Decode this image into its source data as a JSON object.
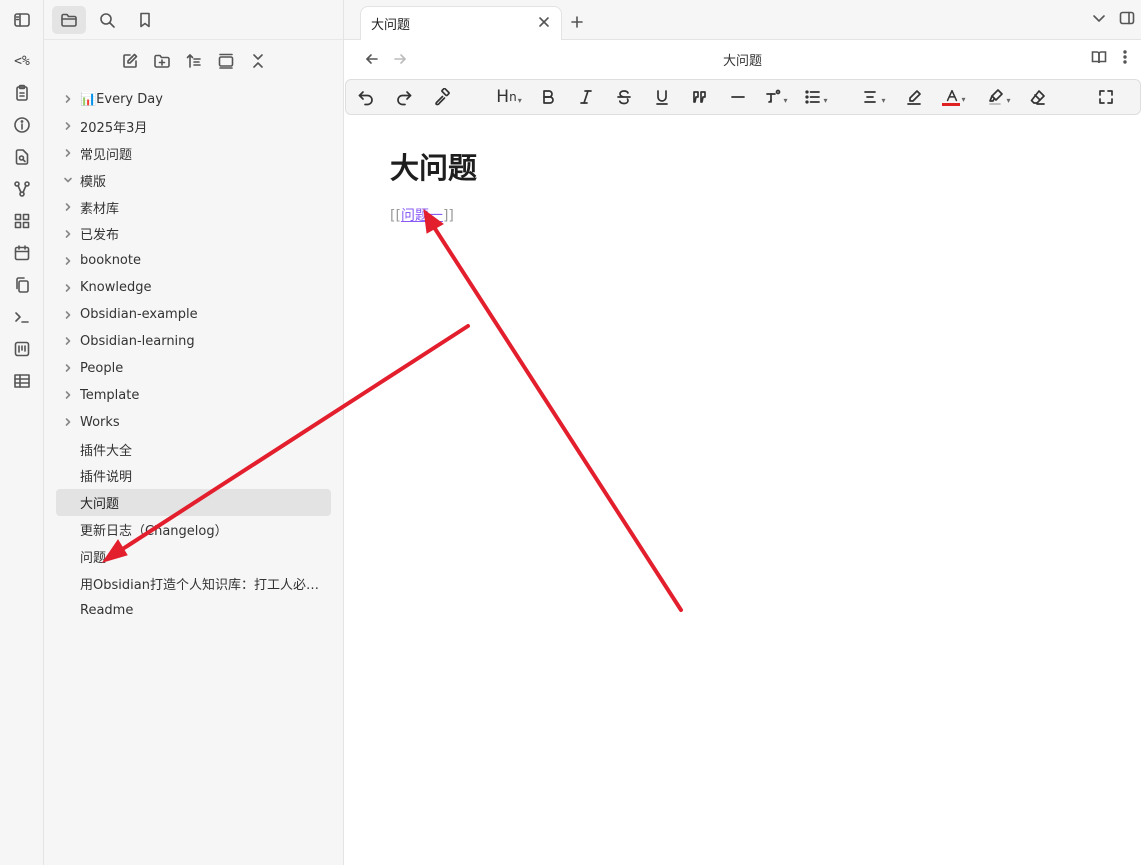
{
  "ribbon": {
    "items": [
      {
        "icon": "template-icon",
        "text": "<%"
      },
      {
        "icon": "clipboard-icon"
      },
      {
        "icon": "info-icon"
      },
      {
        "icon": "file-search-icon"
      },
      {
        "icon": "graph-icon"
      },
      {
        "icon": "grid-icon"
      },
      {
        "icon": "calendar-icon"
      },
      {
        "icon": "copy-icon"
      },
      {
        "icon": "terminal-icon"
      },
      {
        "icon": "kanban-icon"
      },
      {
        "icon": "table-icon"
      }
    ]
  },
  "sidebar": {
    "tree": [
      {
        "label": "📊Every Day",
        "type": "folder",
        "expanded": false
      },
      {
        "label": "2025年3月",
        "type": "folder",
        "expanded": false
      },
      {
        "label": "常见问题",
        "type": "folder",
        "expanded": false
      },
      {
        "label": "模版",
        "type": "folder",
        "expanded": true
      },
      {
        "label": "素材库",
        "type": "folder",
        "expanded": false
      },
      {
        "label": "已发布",
        "type": "folder",
        "expanded": false
      },
      {
        "label": "booknote",
        "type": "folder",
        "expanded": false
      },
      {
        "label": "Knowledge",
        "type": "folder",
        "expanded": false
      },
      {
        "label": "Obsidian-example",
        "type": "folder",
        "expanded": false
      },
      {
        "label": "Obsidian-learning",
        "type": "folder",
        "expanded": false
      },
      {
        "label": "People",
        "type": "folder",
        "expanded": false
      },
      {
        "label": "Template",
        "type": "folder",
        "expanded": false
      },
      {
        "label": "Works",
        "type": "folder",
        "expanded": false
      },
      {
        "label": "插件大全",
        "type": "file"
      },
      {
        "label": "插件说明",
        "type": "file"
      },
      {
        "label": "大问题",
        "type": "file",
        "active": true
      },
      {
        "label": "更新日志（Changelog）",
        "type": "file"
      },
      {
        "label": "问题",
        "type": "file"
      },
      {
        "label": "用Obsidian打造个人知识库：打工人必备...",
        "type": "file"
      },
      {
        "label": "Readme",
        "type": "file"
      }
    ]
  },
  "tabs": [
    {
      "title": "大问题"
    }
  ],
  "view": {
    "title": "大问题"
  },
  "document": {
    "heading": "大问题",
    "link_open": "[[",
    "link_text": "问题一",
    "link_close": "]]"
  },
  "colors": {
    "accent_link": "#8a5cf5",
    "annotation_arrow": "#e31e2d",
    "text_color_bar": "#e02020"
  }
}
